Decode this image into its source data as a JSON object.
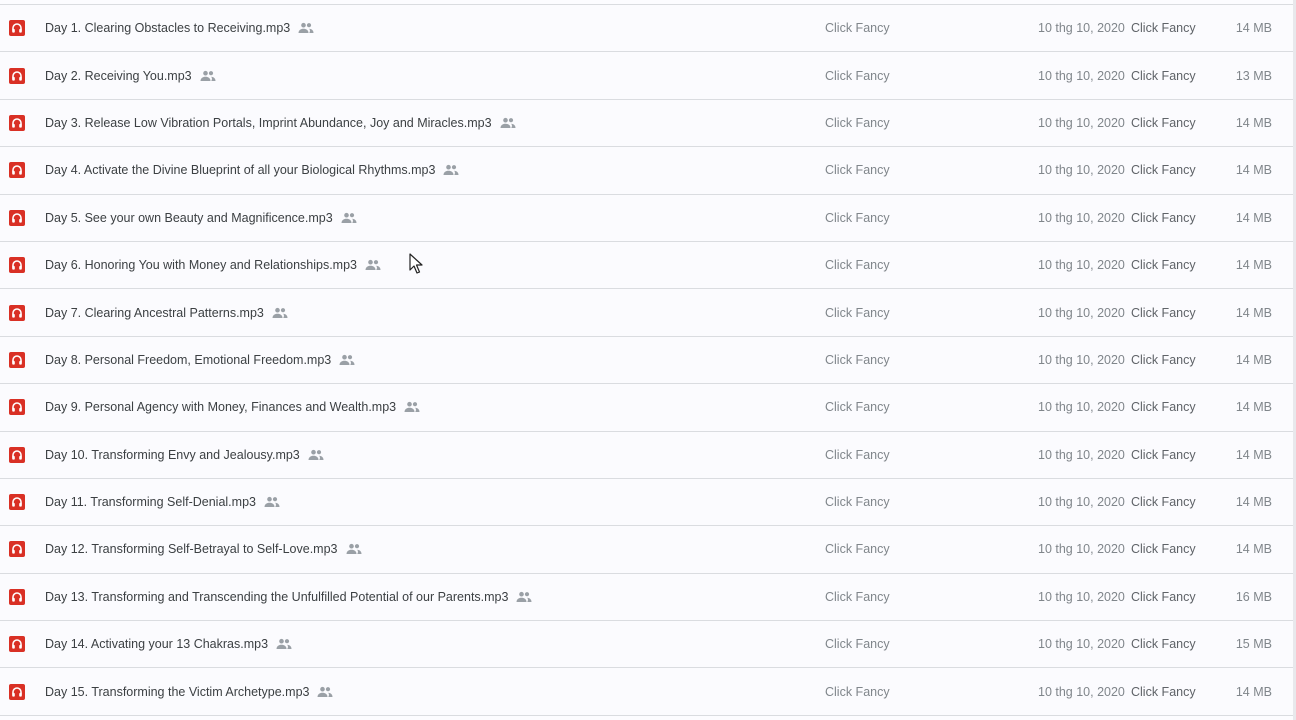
{
  "colors": {
    "audio_icon": "#d93025",
    "shared_icon": "#9aa0a6",
    "divider": "#dadce0"
  },
  "icons": {
    "file": "audio-file-icon",
    "shared": "shared-people-icon",
    "pointer": "mouse-cursor-icon"
  },
  "files": [
    {
      "name": "Day 1. Clearing Obstacles to Receiving.mp3",
      "owner": "Click Fancy",
      "modified": "10 thg 10, 2020",
      "modified_by": "Click Fancy",
      "size": "14 MB"
    },
    {
      "name": "Day 2. Receiving You.mp3",
      "owner": "Click Fancy",
      "modified": "10 thg 10, 2020",
      "modified_by": "Click Fancy",
      "size": "13 MB"
    },
    {
      "name": "Day 3. Release Low Vibration Portals, Imprint Abundance, Joy and Miracles.mp3",
      "owner": "Click Fancy",
      "modified": "10 thg 10, 2020",
      "modified_by": "Click Fancy",
      "size": "14 MB"
    },
    {
      "name": "Day 4. Activate the Divine Blueprint of all your Biological Rhythms.mp3",
      "owner": "Click Fancy",
      "modified": "10 thg 10, 2020",
      "modified_by": "Click Fancy",
      "size": "14 MB"
    },
    {
      "name": "Day 5. See your own Beauty and Magnificence.mp3",
      "owner": "Click Fancy",
      "modified": "10 thg 10, 2020",
      "modified_by": "Click Fancy",
      "size": "14 MB"
    },
    {
      "name": "Day 6. Honoring You with Money and Relationships.mp3",
      "owner": "Click Fancy",
      "modified": "10 thg 10, 2020",
      "modified_by": "Click Fancy",
      "size": "14 MB"
    },
    {
      "name": "Day 7. Clearing Ancestral Patterns.mp3",
      "owner": "Click Fancy",
      "modified": "10 thg 10, 2020",
      "modified_by": "Click Fancy",
      "size": "14 MB"
    },
    {
      "name": "Day 8. Personal Freedom, Emotional Freedom.mp3",
      "owner": "Click Fancy",
      "modified": "10 thg 10, 2020",
      "modified_by": "Click Fancy",
      "size": "14 MB"
    },
    {
      "name": "Day 9. Personal Agency with Money, Finances and Wealth.mp3",
      "owner": "Click Fancy",
      "modified": "10 thg 10, 2020",
      "modified_by": "Click Fancy",
      "size": "14 MB"
    },
    {
      "name": "Day 10. Transforming Envy and Jealousy.mp3",
      "owner": "Click Fancy",
      "modified": "10 thg 10, 2020",
      "modified_by": "Click Fancy",
      "size": "14 MB"
    },
    {
      "name": "Day 11. Transforming Self-Denial.mp3",
      "owner": "Click Fancy",
      "modified": "10 thg 10, 2020",
      "modified_by": "Click Fancy",
      "size": "14 MB"
    },
    {
      "name": "Day 12. Transforming Self-Betrayal to Self-Love.mp3",
      "owner": "Click Fancy",
      "modified": "10 thg 10, 2020",
      "modified_by": "Click Fancy",
      "size": "14 MB"
    },
    {
      "name": "Day 13. Transforming and Transcending the Unfulfilled Potential of our Parents.mp3",
      "owner": "Click Fancy",
      "modified": "10 thg 10, 2020",
      "modified_by": "Click Fancy",
      "size": "16 MB"
    },
    {
      "name": "Day 14. Activating your 13 Chakras.mp3",
      "owner": "Click Fancy",
      "modified": "10 thg 10, 2020",
      "modified_by": "Click Fancy",
      "size": "15 MB"
    },
    {
      "name": "Day 15. Transforming the Victim Archetype.mp3",
      "owner": "Click Fancy",
      "modified": "10 thg 10, 2020",
      "modified_by": "Click Fancy",
      "size": "14 MB"
    }
  ]
}
